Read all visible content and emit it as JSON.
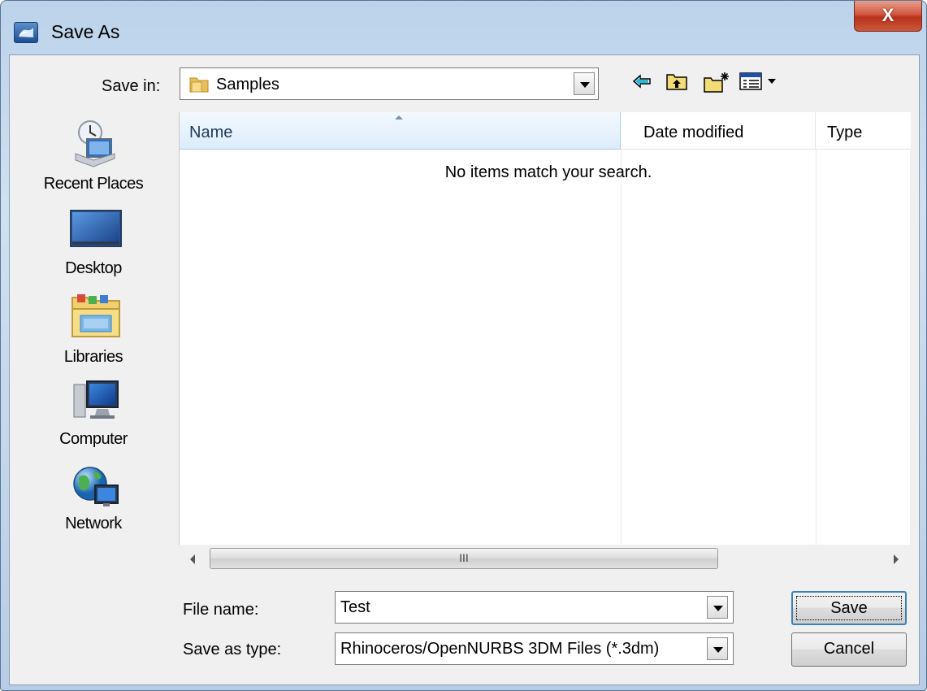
{
  "window": {
    "title": "Save As",
    "close_label": "X"
  },
  "save_in": {
    "label": "Save in:",
    "value": "Samples"
  },
  "places": [
    {
      "label": "Recent Places",
      "icon": "recent-places-icon"
    },
    {
      "label": "Desktop",
      "icon": "desktop-icon"
    },
    {
      "label": "Libraries",
      "icon": "libraries-icon"
    },
    {
      "label": "Computer",
      "icon": "computer-icon"
    },
    {
      "label": "Network",
      "icon": "network-icon"
    }
  ],
  "file_list": {
    "columns": [
      "Name",
      "Date modified",
      "Type"
    ],
    "empty_message": "No items match your search."
  },
  "scrollbar": {
    "grip": "III"
  },
  "file_name": {
    "label": "File name:",
    "value": "Test"
  },
  "save_as_type": {
    "label": "Save as type:",
    "value": "Rhinoceros/OpenNURBS 3DM Files (*.3dm)"
  },
  "buttons": {
    "save": "Save",
    "cancel": "Cancel"
  },
  "toolbar_icons": [
    "back-arrow-icon",
    "up-folder-icon",
    "new-folder-icon",
    "view-menu-icon"
  ]
}
